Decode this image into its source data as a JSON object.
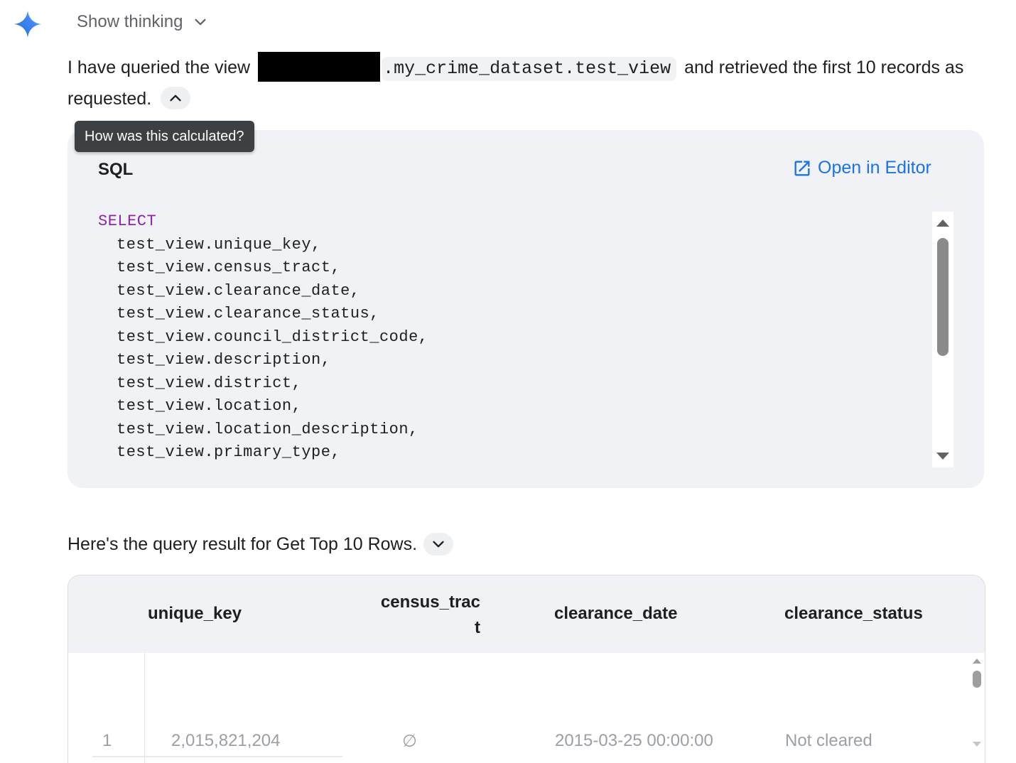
{
  "header": {
    "show_thinking_label": "Show thinking"
  },
  "intro": {
    "text_before": "I have queried the view",
    "view_name": ".my_crime_dataset.test_view",
    "text_after": " and retrieved the first 10 records as requested."
  },
  "tooltip": {
    "text": "How was this calculated?"
  },
  "sql_card": {
    "title": "SQL",
    "open_editor_label": "Open in Editor",
    "keyword": "SELECT",
    "lines": [
      "test_view.unique_key,",
      "test_view.census_tract,",
      "test_view.clearance_date,",
      "test_view.clearance_status,",
      "test_view.council_district_code,",
      "test_view.description,",
      "test_view.district,",
      "test_view.location,",
      "test_view.location_description,",
      "test_view.primary_type,"
    ]
  },
  "result": {
    "heading": "Here's the query result for Get Top 10 Rows."
  },
  "table": {
    "columns": [
      "unique_key",
      "census_tract",
      "clearance_date",
      "clearance_status"
    ],
    "rows": [
      {
        "index": "1",
        "unique_key": "2,015,821,204",
        "census_tract": "∅",
        "clearance_date": "2015-03-25 00:00:00",
        "clearance_status": "Not cleared"
      }
    ]
  },
  "colors": {
    "accent": "#1a73e8",
    "keyword": "#8e24aa",
    "card_bg": "#f0f2f5",
    "tooltip_bg": "#3c4043"
  }
}
